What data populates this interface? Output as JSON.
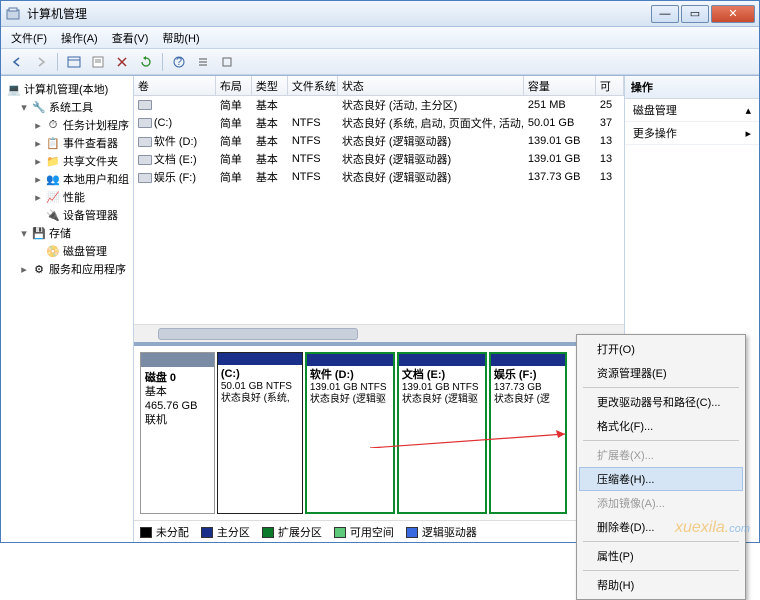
{
  "window": {
    "title": "计算机管理"
  },
  "menu": {
    "file": "文件(F)",
    "action": "操作(A)",
    "view": "查看(V)",
    "help": "帮助(H)"
  },
  "tree": {
    "root": "计算机管理(本地)",
    "systools": "系统工具",
    "sched": "任务计划程序",
    "event": "事件查看器",
    "shared": "共享文件夹",
    "users": "本地用户和组",
    "perf": "性能",
    "devmgr": "设备管理器",
    "storage": "存储",
    "diskmgmt": "磁盘管理",
    "services": "服务和应用程序"
  },
  "cols": {
    "vol": "卷",
    "layout": "布局",
    "type": "类型",
    "fs": "文件系统",
    "status": "状态",
    "cap": "容量",
    "free": "可"
  },
  "rows": [
    {
      "vol": "",
      "layout": "简单",
      "type": "基本",
      "fs": "",
      "status": "状态良好 (活动, 主分区)",
      "cap": "251 MB",
      "free": "25"
    },
    {
      "vol": "(C:)",
      "layout": "简单",
      "type": "基本",
      "fs": "NTFS",
      "status": "状态良好 (系统, 启动, 页面文件, 活动, 主分区)",
      "cap": "50.01 GB",
      "free": "37"
    },
    {
      "vol": "软件 (D:)",
      "layout": "简单",
      "type": "基本",
      "fs": "NTFS",
      "status": "状态良好 (逻辑驱动器)",
      "cap": "139.01 GB",
      "free": "13"
    },
    {
      "vol": "文档 (E:)",
      "layout": "简单",
      "type": "基本",
      "fs": "NTFS",
      "status": "状态良好 (逻辑驱动器)",
      "cap": "139.01 GB",
      "free": "13"
    },
    {
      "vol": "娱乐 (F:)",
      "layout": "简单",
      "type": "基本",
      "fs": "NTFS",
      "status": "状态良好 (逻辑驱动器)",
      "cap": "137.73 GB",
      "free": "13"
    }
  ],
  "disk": {
    "name": "磁盘 0",
    "type": "基本",
    "size": "465.76 GB",
    "state": "联机",
    "parts": [
      {
        "title": "(C:)",
        "l2": "50.01 GB NTFS",
        "l3": "状态良好 (系统,"
      },
      {
        "title": "软件  (D:)",
        "l2": "139.01 GB NTFS",
        "l3": "状态良好 (逻辑驱"
      },
      {
        "title": "文档  (E:)",
        "l2": "139.01 GB NTFS",
        "l3": "状态良好 (逻辑驱"
      },
      {
        "title": "娱乐  (F:)",
        "l2": "137.73 GB",
        "l3": "状态良好 (逻"
      }
    ]
  },
  "legend": {
    "unalloc": "未分配",
    "primary": "主分区",
    "ext": "扩展分区",
    "free": "可用空间",
    "logical": "逻辑驱动器"
  },
  "actions": {
    "header": "操作",
    "diskmgmt": "磁盘管理",
    "more": "更多操作"
  },
  "ctx": {
    "open": "打开(O)",
    "explore": "资源管理器(E)",
    "chgletter": "更改驱动器号和路径(C)...",
    "format": "格式化(F)...",
    "extend": "扩展卷(X)...",
    "shrink": "压缩卷(H)...",
    "mirror": "添加镜像(A)...",
    "delete": "删除卷(D)...",
    "props": "属性(P)",
    "help": "帮助(H)"
  }
}
